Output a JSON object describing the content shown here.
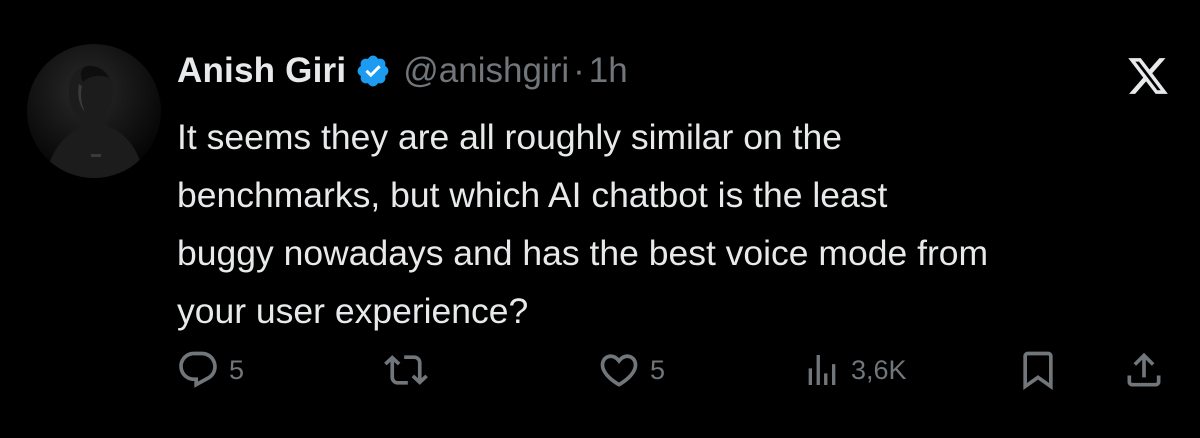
{
  "author": {
    "display_name": "Anish Giri",
    "handle": "@anishgiri",
    "separator": "·",
    "time": "1h"
  },
  "post": {
    "text_lines": [
      "It seems they are all roughly similar on the",
      "benchmarks, but which AI chatbot is the least",
      "buggy nowadays and has the best voice mode from",
      "your user experience?"
    ]
  },
  "actions": {
    "replies": "5",
    "likes": "5",
    "views": "3,6K"
  },
  "icons": {
    "verified": "verified-badge-icon",
    "brand": "x-logo-icon",
    "reply": "reply-icon",
    "repost": "repost-icon",
    "like": "heart-icon",
    "views": "views-icon",
    "bookmark": "bookmark-icon",
    "share": "share-icon"
  },
  "colors": {
    "background": "#000000",
    "text": "#e7e9ea",
    "muted": "#71767b",
    "verified": "#1d9bf0"
  }
}
